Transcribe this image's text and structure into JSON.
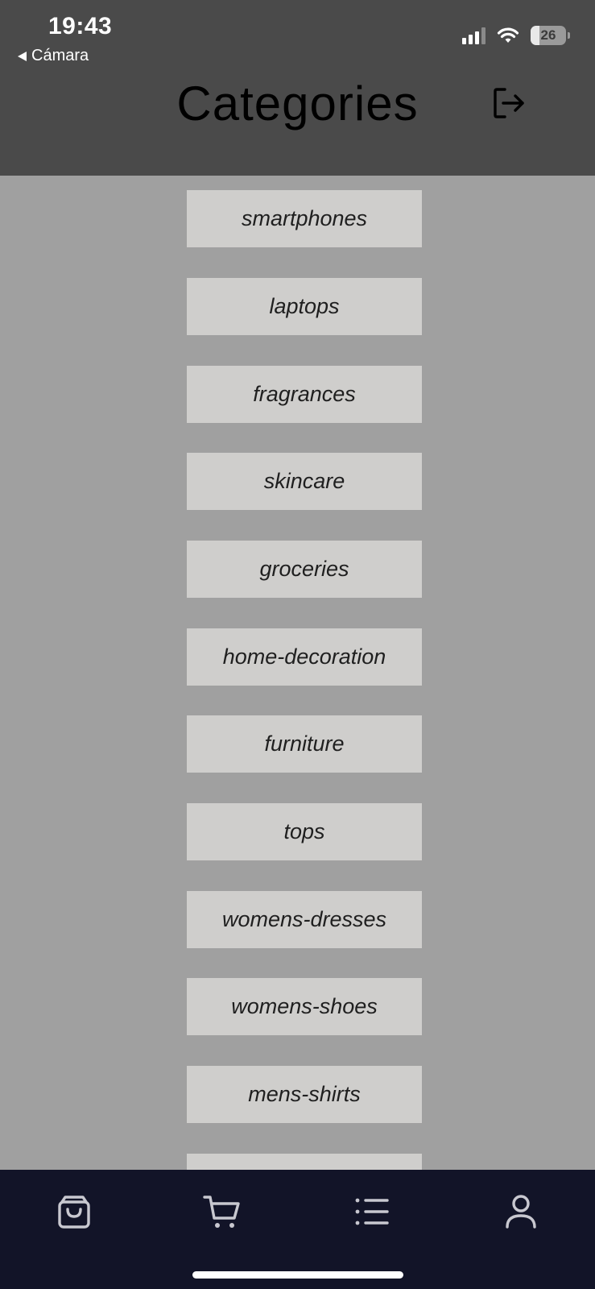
{
  "status_bar": {
    "time": "19:43",
    "back_label": "Cámara",
    "battery": "26",
    "battery_level": 0.26
  },
  "header": {
    "title": "Categories",
    "logout_icon": "logout-icon"
  },
  "categories": [
    "smartphones",
    "laptops",
    "fragrances",
    "skincare",
    "groceries",
    "home-decoration",
    "furniture",
    "tops",
    "womens-dresses",
    "womens-shoes",
    "mens-shirts",
    ""
  ],
  "bottom_nav": [
    {
      "icon": "shopping-bag-icon"
    },
    {
      "icon": "cart-icon"
    },
    {
      "icon": "list-icon"
    },
    {
      "icon": "user-icon"
    }
  ],
  "colors": {
    "header_bg": "#4a4a4a",
    "body_bg": "#a0a0a0",
    "category_bg": "#cfcecc",
    "nav_bg": "#121428",
    "nav_icon": "#c8c8d0"
  }
}
